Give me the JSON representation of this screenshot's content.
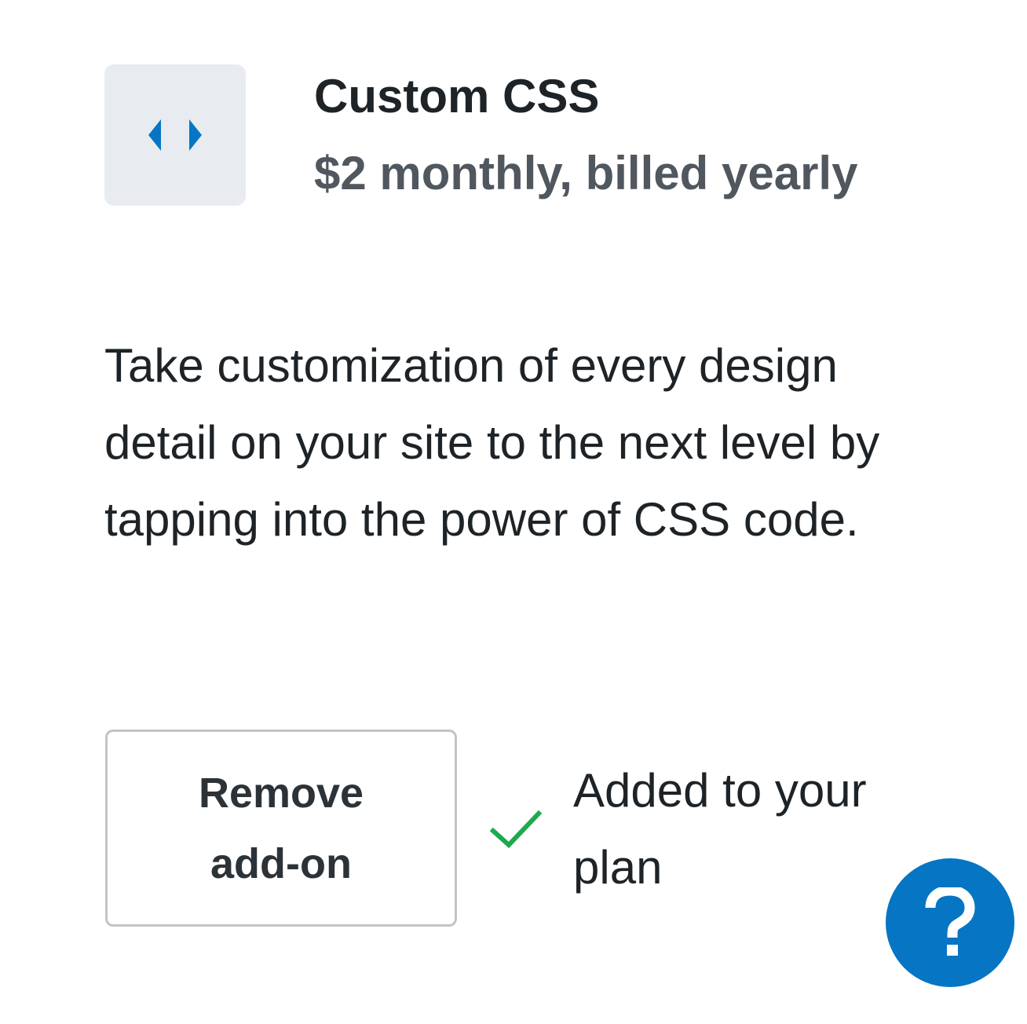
{
  "addon": {
    "icon": "code-arrows-icon",
    "title": "Custom CSS",
    "price": "$2 monthly, billed yearly",
    "description": "Take customization of every design detail on your site to the next level by tapping into the power of CSS code.",
    "remove_label": "Remove add-on",
    "status_icon": "checkmark-icon",
    "status_text": "Added to your plan"
  },
  "help": {
    "icon": "question-mark-icon"
  },
  "colors": {
    "accent_blue": "#0675c4",
    "success_green": "#1ea94f",
    "icon_tile_bg": "#e8ecf0",
    "text_primary": "#1d2327",
    "text_secondary": "#50575e",
    "button_border": "#c3c4c7"
  }
}
